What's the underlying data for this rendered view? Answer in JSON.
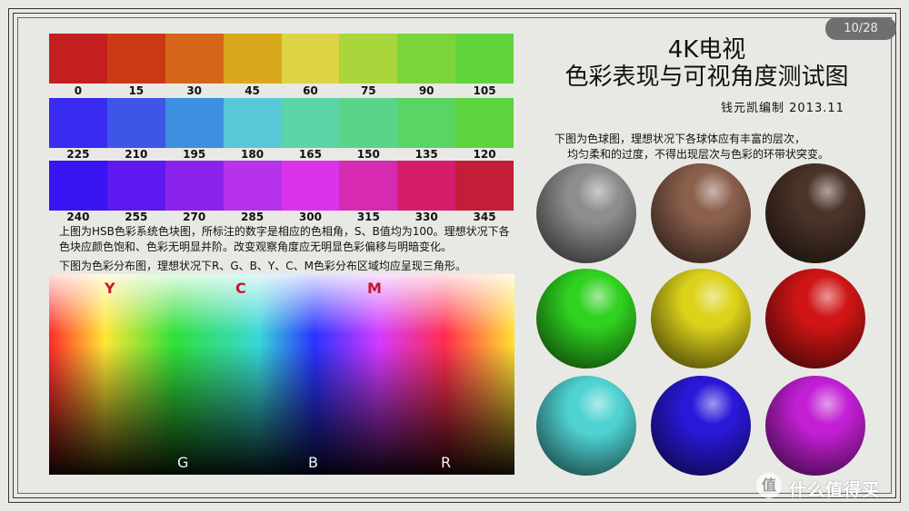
{
  "page_indicator": "10/28",
  "title_line1": "4K电视",
  "title_line2": "色彩表现与可视角度测试图",
  "author": "钱元凯编制  2013.11",
  "hue_rows": [
    {
      "hues": [
        "0",
        "15",
        "30",
        "45",
        "60",
        "75",
        "90",
        "105"
      ],
      "colors": [
        "#c41f1f",
        "#c93a14",
        "#d4661c",
        "#d9a81b",
        "#dcd444",
        "#a9d63d",
        "#7bd43b",
        "#5fd43c"
      ]
    },
    {
      "hues": [
        "225",
        "210",
        "195",
        "180",
        "165",
        "150",
        "135",
        "120"
      ],
      "colors": [
        "#3a2bf0",
        "#3f55e8",
        "#3d8fe0",
        "#58c8d8",
        "#5cd4a5",
        "#5ad488",
        "#5ad462",
        "#5cd43f"
      ]
    },
    {
      "hues": [
        "240",
        "255",
        "270",
        "285",
        "300",
        "315",
        "330",
        "345"
      ],
      "colors": [
        "#3a14f2",
        "#5e18f0",
        "#8a22ee",
        "#b732ec",
        "#db33ea",
        "#d62ab0",
        "#d61d6c",
        "#c41d37"
      ]
    }
  ],
  "description_hue": "上图为HSB色彩系统色块图，所标注的数字是相应的色相角，S、B值均为100。理想状况下各色块应颜色饱和、色彩无明显并阶。改变观察角度应无明显色彩偏移与明暗变化。",
  "description_gradient": "下图为色彩分布图，理想状况下R、G、B、Y、C、M色彩分布区域均应呈现三角形。",
  "gradient_top_labels": [
    "Y",
    "C",
    "M"
  ],
  "gradient_bottom_labels": [
    "G",
    "B",
    "R"
  ],
  "sphere_description": [
    "下图为色球图，理想状况下各球体应有丰富的层次，",
    "均匀柔和的过度，不得出现层次与色彩的环带状突变。"
  ],
  "spheres": [
    {
      "name": "gray",
      "color": "#8d8d8d"
    },
    {
      "name": "brown",
      "color": "#8a5f4c"
    },
    {
      "name": "dark-brown",
      "color": "#4a3328"
    },
    {
      "name": "green",
      "color": "#2fd21f"
    },
    {
      "name": "yellow",
      "color": "#dcd21a"
    },
    {
      "name": "red",
      "color": "#cf1515"
    },
    {
      "name": "cyan",
      "color": "#4fd2d2"
    },
    {
      "name": "blue",
      "color": "#2a18d8"
    },
    {
      "name": "magenta",
      "color": "#c21fd4"
    }
  ],
  "watermark_icon": "值",
  "watermark": "什么值得买"
}
